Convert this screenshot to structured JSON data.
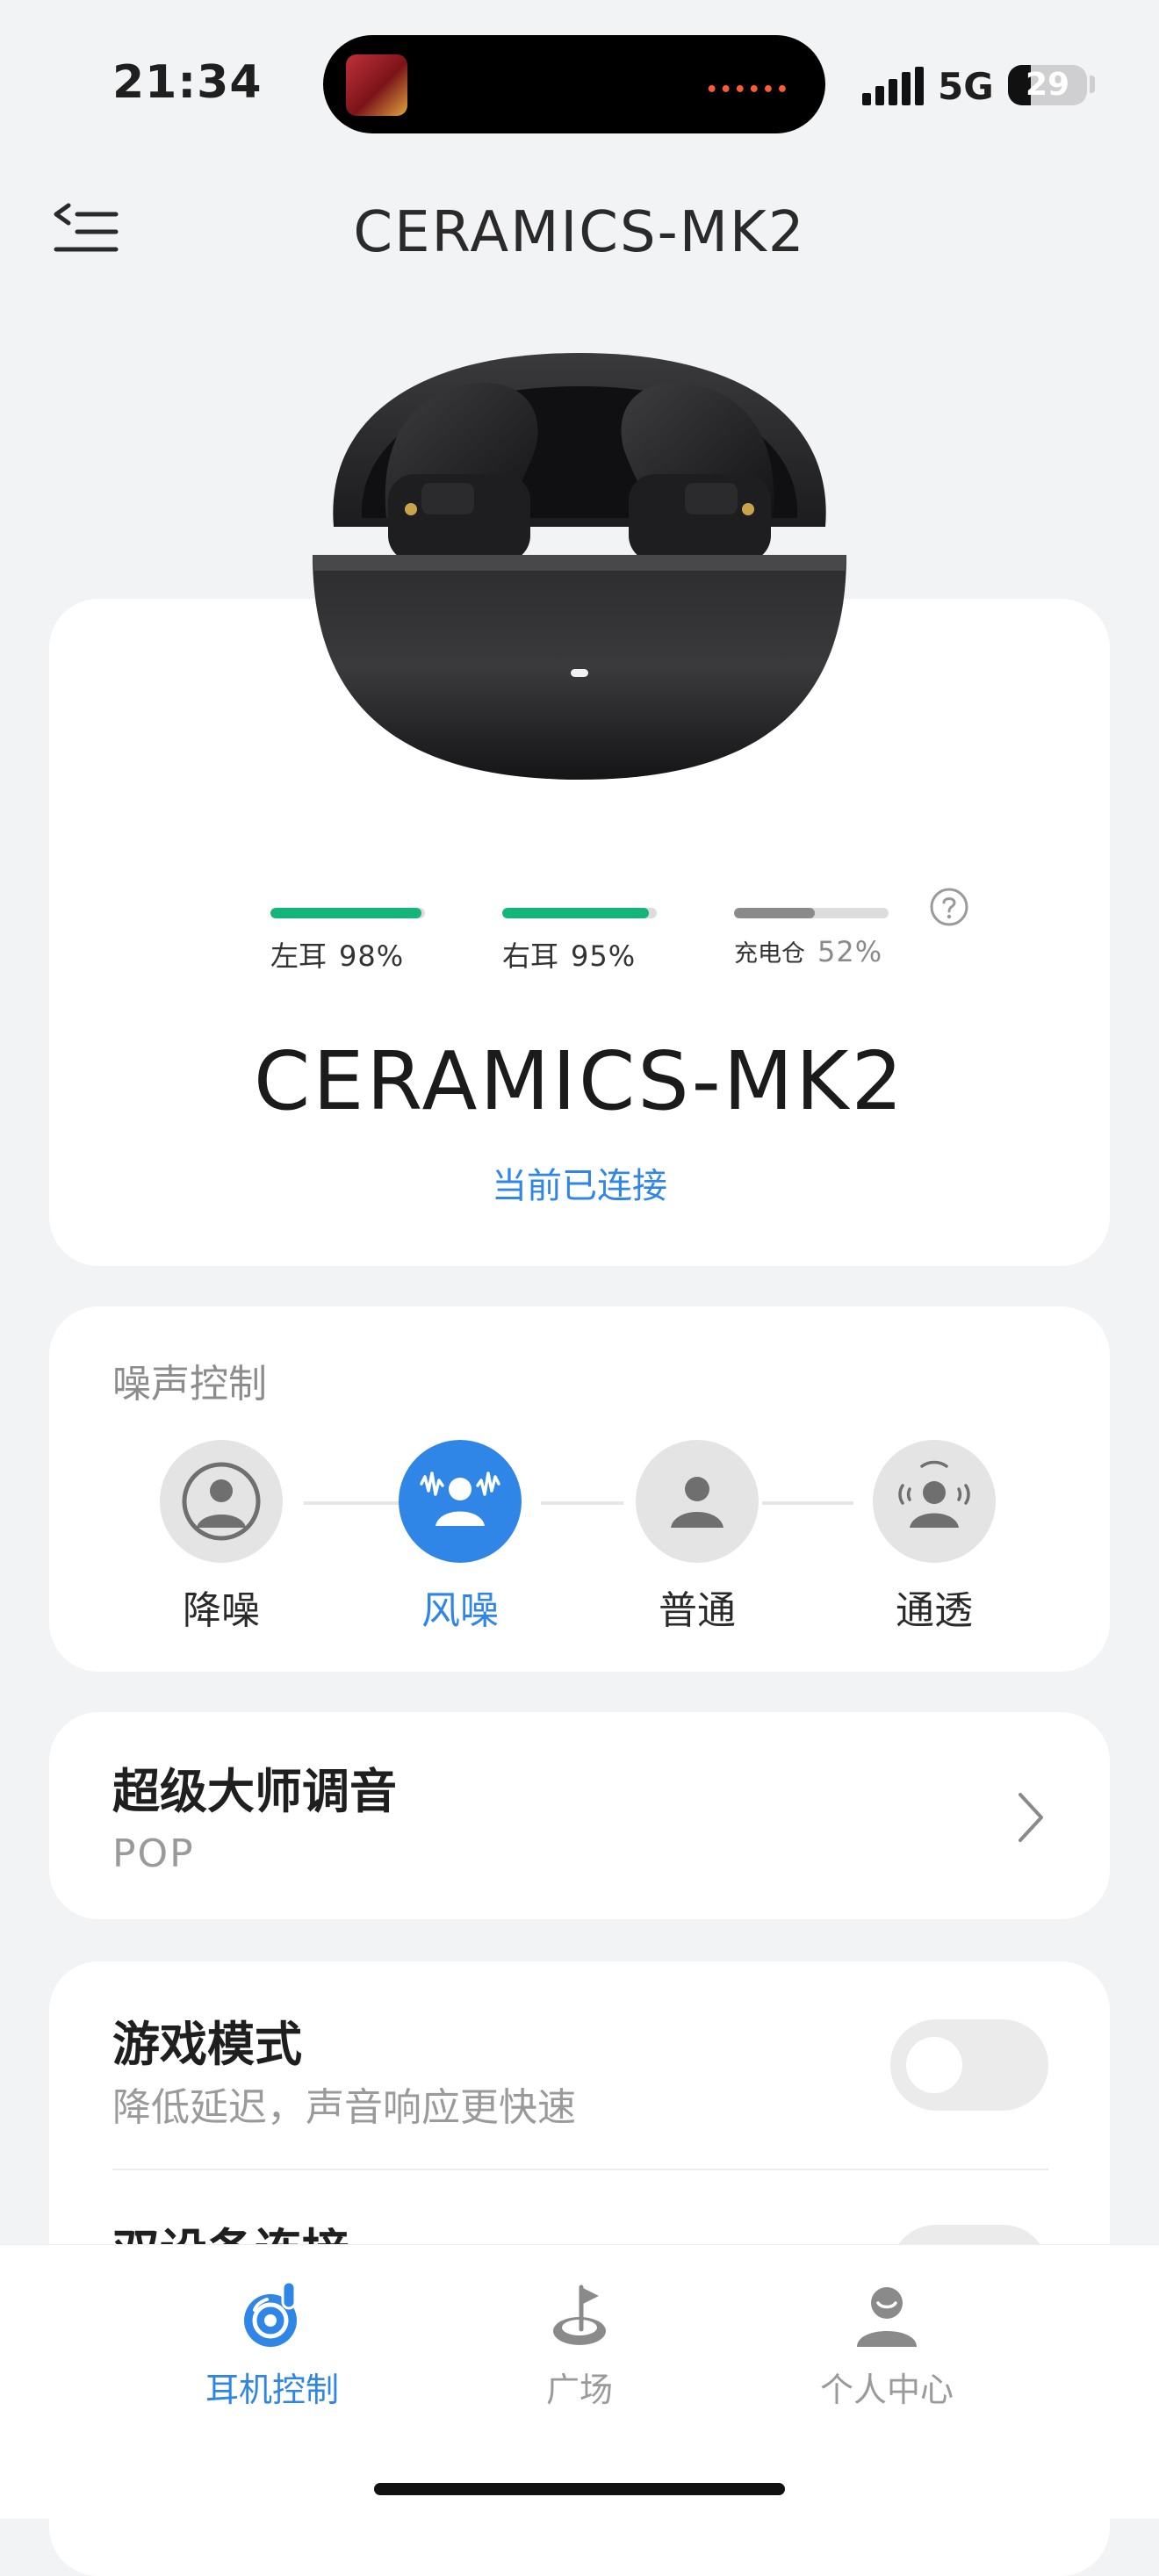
{
  "status_bar": {
    "time": "21:34",
    "network": "5G",
    "battery_level": "29",
    "battery_fraction": 0.29
  },
  "header": {
    "title": "CERAMICS-MK2",
    "menu_icon": "menu-list-icon"
  },
  "device": {
    "image": "earbuds-charging-case",
    "batteries": [
      {
        "label": "左耳",
        "value": "98%",
        "level": 0.98,
        "color": "#13b57a"
      },
      {
        "label": "右耳",
        "value": "95%",
        "level": 0.95,
        "color": "#13b57a"
      },
      {
        "label": "充电仓",
        "value": "52%",
        "level": 0.52,
        "color": "#8a8a8a"
      }
    ],
    "name": "CERAMICS-MK2",
    "connection_status": "当前已连接"
  },
  "noise_control": {
    "title": "噪声控制",
    "modes": [
      {
        "label": "降噪",
        "icon": "noise-cancel-icon",
        "active": false
      },
      {
        "label": "风噪",
        "icon": "wind-noise-icon",
        "active": true
      },
      {
        "label": "普通",
        "icon": "normal-mode-icon",
        "active": false
      },
      {
        "label": "通透",
        "icon": "transparency-icon",
        "active": false
      }
    ]
  },
  "master_tuning": {
    "title": "超级大师调音",
    "value": "POP"
  },
  "game_mode": {
    "title": "游戏模式",
    "description": "降低延迟，声音响应更快速",
    "enabled": false
  },
  "dual_connect": {
    "title": "双设备连接",
    "enabled": false
  },
  "bottom_nav": {
    "items": [
      {
        "label": "耳机控制",
        "icon": "earphone-control-icon",
        "active": true
      },
      {
        "label": "广场",
        "icon": "square-flag-icon",
        "active": false
      },
      {
        "label": "个人中心",
        "icon": "profile-icon",
        "active": false
      }
    ]
  },
  "colors": {
    "accent": "#2f86e6",
    "battery_green": "#13b57a",
    "background": "#f2f3f5"
  }
}
